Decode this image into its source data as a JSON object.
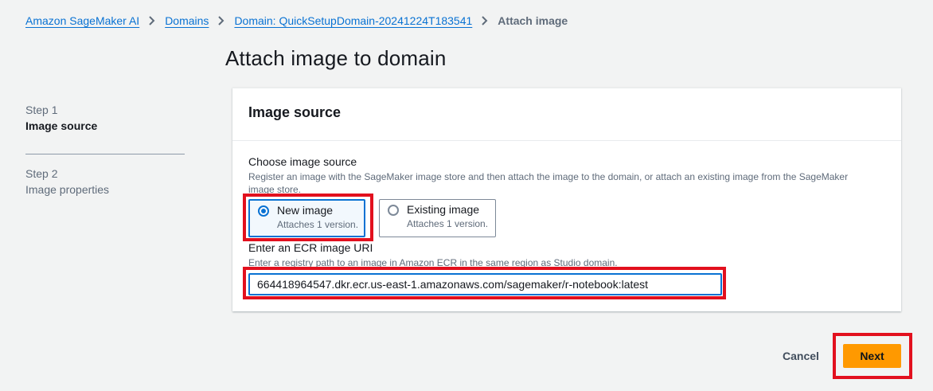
{
  "breadcrumb": {
    "items": [
      "Amazon SageMaker AI",
      "Domains",
      "Domain: QuickSetupDomain-20241224T183541"
    ],
    "current": "Attach image"
  },
  "page": {
    "title": "Attach image to domain"
  },
  "steps": [
    {
      "number": "Step 1",
      "name": "Image source",
      "active": true
    },
    {
      "number": "Step 2",
      "name": "Image properties",
      "active": false
    }
  ],
  "panel": {
    "title": "Image source",
    "choose_label": "Choose image source",
    "choose_desc": "Register an image with the SageMaker image store and then attach the image to the domain, or attach an existing image from the SageMaker image store.",
    "options": [
      {
        "label": "New image",
        "desc": "Attaches 1 version.",
        "selected": true
      },
      {
        "label": "Existing image",
        "desc": "Attaches 1 version.",
        "selected": false
      }
    ],
    "uri_label": "Enter an ECR image URI",
    "uri_desc": "Enter a registry path to an image in Amazon ECR in the same region as Studio domain.",
    "uri_value": "664418964547.dkr.ecr.us-east-1.amazonaws.com/sagemaker/r-notebook:latest"
  },
  "actions": {
    "cancel": "Cancel",
    "next": "Next"
  },
  "colors": {
    "link": "#0972d3",
    "primary_button": "#ff9900",
    "highlight": "#e2101e",
    "selected_bg": "#f2f8fd"
  }
}
